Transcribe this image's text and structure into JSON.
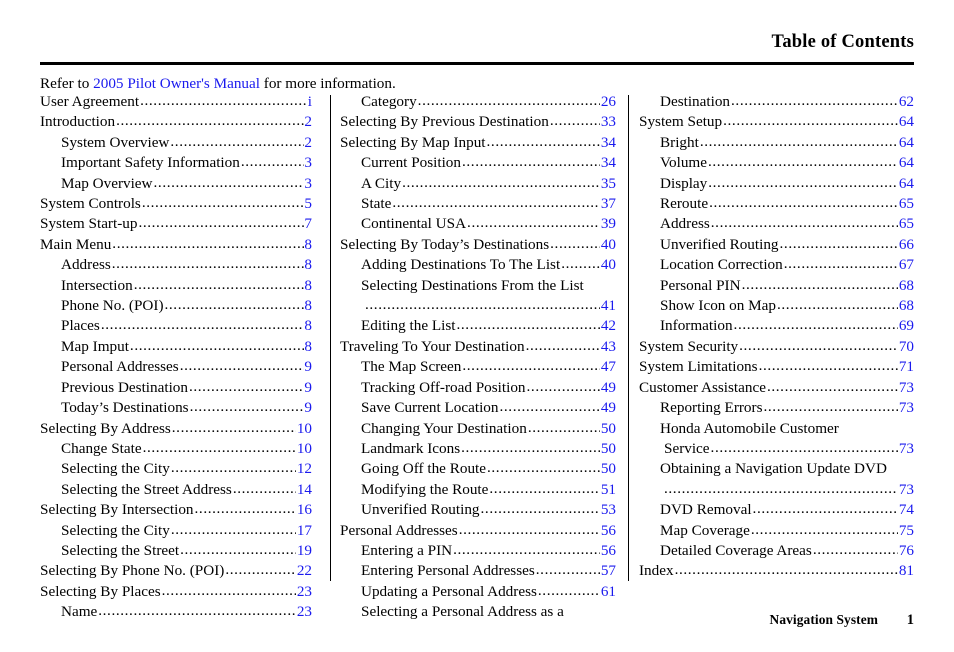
{
  "header": {
    "title": "Table of Contents"
  },
  "intro": {
    "prefix": "Refer to ",
    "link": "2005 Pilot Owner's Manual",
    "suffix": " for more information."
  },
  "colors": {
    "page_number": "#1a1aee",
    "link": "#1a1aee",
    "text": "#000000",
    "rule": "#000000"
  },
  "columns": [
    {
      "name": "column-left",
      "entries": [
        {
          "title": "User Agreement",
          "page": "i",
          "level": 0,
          "gap": true
        },
        {
          "title": "Introduction",
          "page": "2",
          "level": 0,
          "gap": true
        },
        {
          "title": "System Overview",
          "page": "2",
          "level": 1,
          "gap": true
        },
        {
          "title": "Important Safety Information",
          "page": "3",
          "level": 1,
          "gap": true
        },
        {
          "title": "Map Overview",
          "page": "3",
          "level": 1,
          "gap": true
        },
        {
          "title": "System Controls",
          "page": "5",
          "level": 0,
          "gap": false
        },
        {
          "title": "System Start-up",
          "page": "7",
          "level": 0,
          "gap": true
        },
        {
          "title": "Main Menu",
          "page": "8",
          "level": 0,
          "gap": true
        },
        {
          "title": "Address",
          "page": "8",
          "level": 1,
          "gap": true
        },
        {
          "title": "Intersection",
          "page": "8",
          "level": 1,
          "gap": true
        },
        {
          "title": "Phone No. (POI)",
          "page": "8",
          "level": 1,
          "gap": true
        },
        {
          "title": "Places",
          "page": "8",
          "level": 1,
          "gap": true
        },
        {
          "title": "Map Imput",
          "page": "8",
          "level": 1,
          "gap": true
        },
        {
          "title": "Personal Addresses",
          "page": "9",
          "level": 1,
          "gap": true
        },
        {
          "title": "Previous Destination",
          "page": "9",
          "level": 1,
          "gap": true
        },
        {
          "title": "Today’s Destinations",
          "page": "9",
          "level": 1,
          "gap": true
        },
        {
          "title": "Selecting By Address",
          "page": "10",
          "level": 0,
          "gap": true
        },
        {
          "title": "Change State",
          "page": "10",
          "level": 1,
          "gap": true
        },
        {
          "title": "Selecting the City",
          "page": "12",
          "level": 1,
          "gap": true
        },
        {
          "title": "Selecting the Street Address",
          "page": "14",
          "level": 1,
          "gap": true
        },
        {
          "title": "Selecting By Intersection",
          "page": "16",
          "level": 0,
          "gap": false
        },
        {
          "title": "Selecting the City",
          "page": "17",
          "level": 1,
          "gap": true
        },
        {
          "title": "Selecting the Street",
          "page": "19",
          "level": 1,
          "gap": true
        },
        {
          "title": "Selecting By Phone No. (POI)",
          "page": "22",
          "level": 0,
          "gap": false
        },
        {
          "title": "Selecting By Places",
          "page": "23",
          "level": 0,
          "gap": true
        },
        {
          "title": "Name",
          "page": "23",
          "level": 1,
          "gap": true
        }
      ]
    },
    {
      "name": "column-middle",
      "entries": [
        {
          "title": "Category",
          "page": "26",
          "level": 1,
          "gap": true
        },
        {
          "title": "Selecting By Previous Destination",
          "page": "33",
          "level": 0,
          "gap": true
        },
        {
          "title": "Selecting By Map Input",
          "page": "34",
          "level": 0,
          "gap": false
        },
        {
          "title": "Current Position",
          "page": "34",
          "level": 1,
          "gap": true
        },
        {
          "title": "A City",
          "page": "35",
          "level": 1,
          "gap": true
        },
        {
          "title": "State",
          "page": "37",
          "level": 1,
          "gap": true
        },
        {
          "title": "Continental USA",
          "page": "39",
          "level": 1,
          "gap": true
        },
        {
          "title": "Selecting By Today’s Destinations",
          "page": "40",
          "level": 0,
          "gap": true
        },
        {
          "title": "Adding Destinations To The List",
          "page": "40",
          "level": 1,
          "gap": false
        },
        {
          "title": "Selecting Destinations From the List",
          "page": "",
          "level": 1,
          "gap": false,
          "wrap": true
        },
        {
          "title": "",
          "page": "41",
          "level": 1,
          "gap": false,
          "continuation": true
        },
        {
          "title": "Editing the List",
          "page": "42",
          "level": 1,
          "gap": true
        },
        {
          "title": "Traveling To Your Destination",
          "page": "43",
          "level": 0,
          "gap": true
        },
        {
          "title": "The Map Screen",
          "page": "47",
          "level": 1,
          "gap": false
        },
        {
          "title": "Tracking Off-road Position",
          "page": "49",
          "level": 1,
          "gap": true
        },
        {
          "title": "Save Current Location",
          "page": "49",
          "level": 1,
          "gap": true
        },
        {
          "title": "Changing Your Destination",
          "page": "50",
          "level": 1,
          "gap": false
        },
        {
          "title": "Landmark Icons",
          "page": "50",
          "level": 1,
          "gap": true
        },
        {
          "title": "Going Off the Route",
          "page": "50",
          "level": 1,
          "gap": true
        },
        {
          "title": "Modifying the Route",
          "page": "51",
          "level": 1,
          "gap": true
        },
        {
          "title": "Unverified Routing",
          "page": "53",
          "level": 1,
          "gap": true
        },
        {
          "title": "Personal Addresses",
          "page": "56",
          "level": 0,
          "gap": true
        },
        {
          "title": "Entering a PIN",
          "page": "56",
          "level": 1,
          "gap": true
        },
        {
          "title": "Entering Personal Addresses",
          "page": "57",
          "level": 1,
          "gap": true
        },
        {
          "title": "Updating a Personal Address",
          "page": "61",
          "level": 1,
          "gap": true
        },
        {
          "title": "Selecting a Personal Address as a",
          "page": "",
          "level": 1,
          "gap": false,
          "wrap": true
        }
      ]
    },
    {
      "name": "column-right",
      "entries": [
        {
          "title": "Destination",
          "page": "62",
          "level": 1,
          "gap": false
        },
        {
          "title": "System Setup",
          "page": "64",
          "level": 0,
          "gap": true
        },
        {
          "title": "Bright",
          "page": "64",
          "level": 1,
          "gap": false
        },
        {
          "title": "Volume",
          "page": "64",
          "level": 1,
          "gap": false
        },
        {
          "title": "Display",
          "page": "64",
          "level": 1,
          "gap": false
        },
        {
          "title": "Reroute",
          "page": "65",
          "level": 1,
          "gap": true
        },
        {
          "title": "Address",
          "page": "65",
          "level": 1,
          "gap": true
        },
        {
          "title": "Unverified Routing",
          "page": "66",
          "level": 1,
          "gap": true
        },
        {
          "title": "Location Correction",
          "page": "67",
          "level": 1,
          "gap": false
        },
        {
          "title": "Personal PIN",
          "page": "68",
          "level": 1,
          "gap": true
        },
        {
          "title": "Show Icon on Map",
          "page": "68",
          "level": 1,
          "gap": false
        },
        {
          "title": "Information",
          "page": "69",
          "level": 1,
          "gap": true
        },
        {
          "title": "System Security",
          "page": "70",
          "level": 0,
          "gap": true
        },
        {
          "title": "System Limitations",
          "page": "71",
          "level": 0,
          "gap": true
        },
        {
          "title": "Customer Assistance",
          "page": "73",
          "level": 0,
          "gap": true
        },
        {
          "title": "Reporting Errors",
          "page": "73",
          "level": 1,
          "gap": true
        },
        {
          "title": "Honda Automobile Customer",
          "page": "",
          "level": 1,
          "gap": false,
          "wrap": true
        },
        {
          "title": "Service",
          "page": "73",
          "level": 1,
          "gap": true,
          "hang": true
        },
        {
          "title": "Obtaining a Navigation Update DVD",
          "page": "",
          "level": 1,
          "gap": false,
          "wrap": true
        },
        {
          "title": "",
          "page": "73",
          "level": 1,
          "gap": false,
          "continuation": true
        },
        {
          "title": "DVD Removal",
          "page": "74",
          "level": 1,
          "gap": true
        },
        {
          "title": "Map Coverage",
          "page": "75",
          "level": 1,
          "gap": true
        },
        {
          "title": "Detailed Coverage Areas",
          "page": "76",
          "level": 1,
          "gap": true
        },
        {
          "title": "Index",
          "page": "81",
          "level": 0,
          "gap": true
        }
      ]
    }
  ],
  "footer": {
    "label": "Navigation System",
    "page": "1"
  }
}
